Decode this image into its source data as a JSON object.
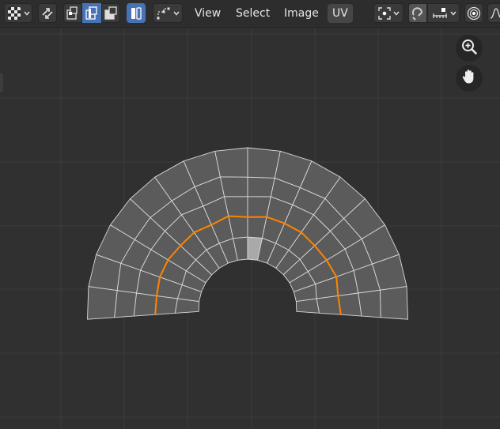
{
  "header": {
    "menus": {
      "view": "View",
      "select": "Select",
      "image": "Image",
      "uv": "UV"
    }
  },
  "icons": {
    "editor_type": "checker-grid-icon",
    "sync": "uv-sync-selection-icon",
    "select_vertex": "vertex-select-icon",
    "select_edge": "edge-select-icon",
    "select_face": "face-select-icon",
    "select_island": "island-select-icon",
    "sticky_mode": "sticky-selection-icon",
    "pivot": "pivot-point-icon",
    "snap": "snap-magnet-icon",
    "snap_target": "snap-target-icon",
    "proportional": "proportional-edit-icon",
    "falloff": "falloff-curve-icon",
    "zoom": "zoom-in-icon",
    "pan": "hand-pan-icon"
  },
  "colors": {
    "background": "#303030",
    "grid_line": "#3d3d3d",
    "face_fill": "#5b5b5b",
    "face_edge": "#d8d8d8",
    "seam": "#ff8400",
    "selected_face": "#a9a9a9",
    "active_button": "#4772b3"
  },
  "uv_mesh": {
    "rings": 5,
    "segments": 16,
    "start_angle_deg": -4,
    "end_angle_deg": 184,
    "seam_ring_index": 2,
    "selected_face": {
      "ring": 0,
      "segment": 7
    }
  }
}
